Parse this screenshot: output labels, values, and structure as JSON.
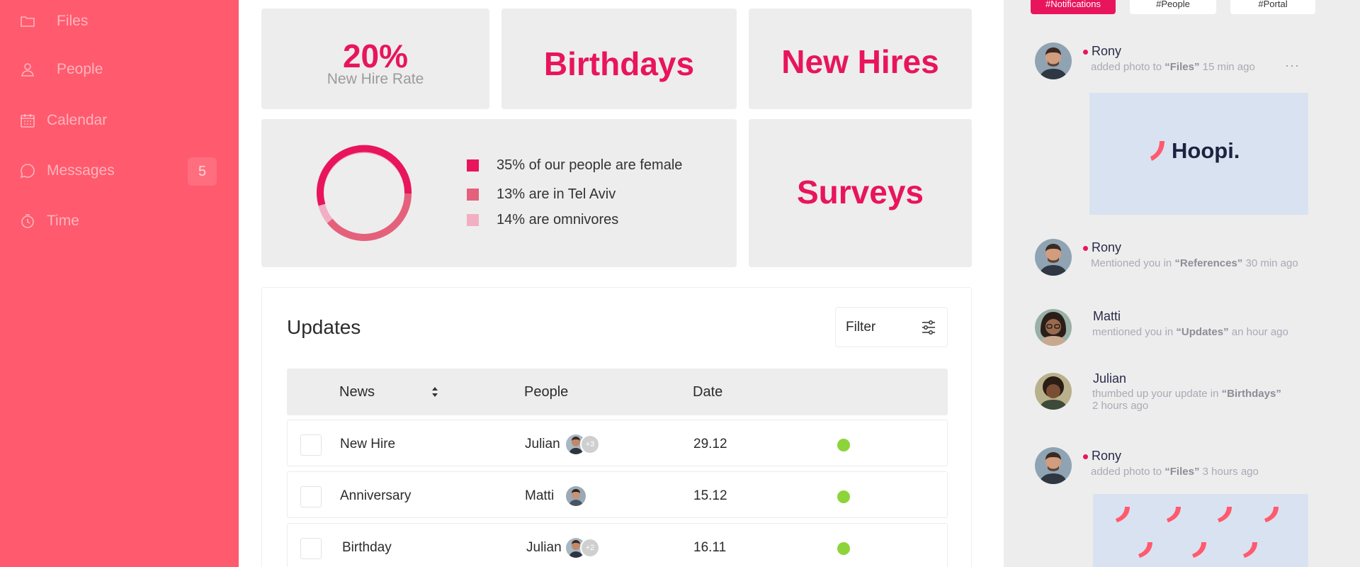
{
  "colors": {
    "sidebar": "#ff5a6e",
    "accent": "#e8155c",
    "card": "#ededed",
    "status_green": "#8dd43a"
  },
  "sidebar": {
    "items": [
      {
        "label": "Files",
        "icon": "folder-icon"
      },
      {
        "label": "People",
        "icon": "user-icon"
      },
      {
        "label": "Calendar",
        "icon": "calendar-icon"
      },
      {
        "label": "Messages",
        "icon": "chat-icon",
        "badge": "5"
      },
      {
        "label": "Time",
        "icon": "clock-icon"
      }
    ]
  },
  "stats": {
    "rate_value": "20%",
    "rate_label": "New Hire Rate",
    "birthdays": "Birthdays",
    "new_hires": "New Hires",
    "surveys": "Surveys"
  },
  "donut": {
    "legend": [
      {
        "text": "35% of our people are female",
        "color": "#e8155c",
        "percent": 35
      },
      {
        "text": "13% are in Tel Aviv",
        "color": "#e4617c",
        "percent": 13
      },
      {
        "text": "14% are omnivores",
        "color": "#f2afc4",
        "percent": 14
      }
    ]
  },
  "updates": {
    "title": "Updates",
    "filter_label": "Filter",
    "columns": [
      "News",
      "People",
      "Date"
    ],
    "rows": [
      {
        "news": "New Hire",
        "person": "Julian",
        "extra": "+3",
        "date": "29.12",
        "status": "green"
      },
      {
        "news": "Anniversary",
        "person": "Matti",
        "extra": "",
        "date": "15.12",
        "status": "green"
      },
      {
        "news": "Birthday",
        "person": "Julian",
        "extra": "+2",
        "date": "16.11",
        "status": "green"
      }
    ]
  },
  "right_panel": {
    "tags": [
      "#Notifications",
      "#People",
      "#Portal"
    ],
    "activities": [
      {
        "name": "Rony",
        "text_before": "added photo to ",
        "highlight": "“Files”",
        "text_after": " 15 min ago",
        "has_dot": true
      },
      {
        "name": "Rony",
        "text_before": "Mentioned you in ",
        "highlight": "“References”",
        "text_after": " 30 min ago",
        "has_dot": true
      },
      {
        "name": "Matti",
        "text_before": "mentioned you in  ",
        "highlight": "“Updates”",
        "text_after": "   an hour ago",
        "has_dot": false
      },
      {
        "name": "Julian",
        "text_before": "thumbed up your update  in  ",
        "highlight": "“Birthdays”",
        "text_after": "",
        "time_line": "2 hours ago",
        "has_dot": false
      },
      {
        "name": "Rony",
        "text_before": "added photo to ",
        "highlight": "“Files”",
        "text_after": " 3 hours ago",
        "has_dot": true
      }
    ],
    "hoopi_logo_text": "Hoopi."
  }
}
